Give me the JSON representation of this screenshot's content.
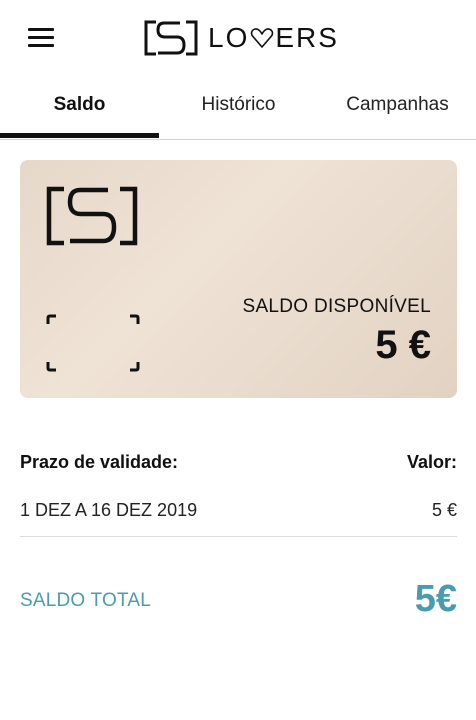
{
  "header": {
    "brand_text_left": "LO",
    "brand_text_right": "ERS",
    "icons": [
      "menu-icon",
      "brand-logo-icon",
      "heart-icon"
    ]
  },
  "tabs": [
    {
      "label": "Saldo",
      "active": true
    },
    {
      "label": "Histórico",
      "active": false
    },
    {
      "label": "Campanhas",
      "active": false
    }
  ],
  "card": {
    "label": "SALDO DISPONÍVEL",
    "amount": "5 €",
    "icons": [
      "card-logo-icon",
      "scan-frame-icon"
    ]
  },
  "details": {
    "period_header": "Prazo de validade:",
    "value_header": "Valor:",
    "rows": [
      {
        "period": "1 DEZ A 16 DEZ 2019",
        "value": "5 €"
      }
    ]
  },
  "total": {
    "label": "SALDO TOTAL",
    "value": "5€"
  },
  "colors": {
    "accent": "#4a9bb0",
    "card_background": "#e8dacb",
    "text": "#111111"
  }
}
